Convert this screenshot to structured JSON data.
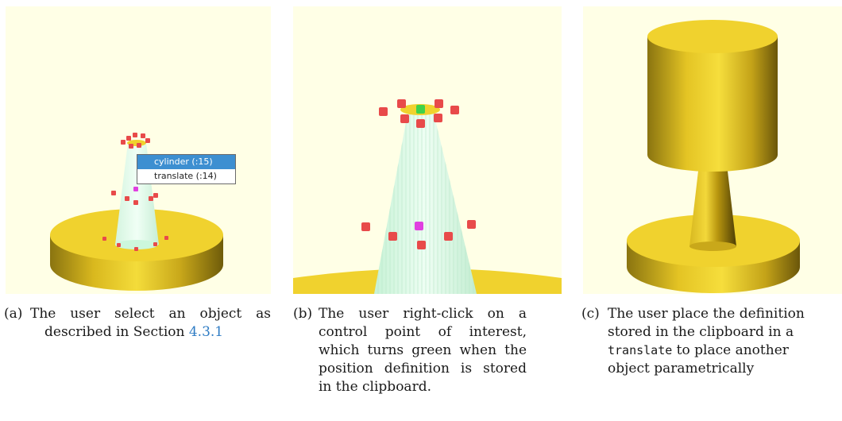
{
  "figure": {
    "panels": [
      {
        "id": "a",
        "context_menu": {
          "items": [
            {
              "label": "cylinder (:15)",
              "selected": true
            },
            {
              "label": "translate (:14)",
              "selected": false
            }
          ]
        }
      },
      {
        "id": "b"
      },
      {
        "id": "c"
      }
    ],
    "captions": {
      "a": {
        "tag": "(a)",
        "line1": "The user select an object as",
        "line2_pre": "described in Section ",
        "line2_link": "4.3.1"
      },
      "b": {
        "tag": "(b)",
        "line1": "The user right-click on a",
        "line2": "control point of interest,",
        "line3": "which turns green when the",
        "line4": "position definition is stored",
        "line5": "in the clipboard."
      },
      "c": {
        "tag": "(c)",
        "line1": "The user place the definition",
        "line2": "stored in the clipboard in a",
        "line3_code": "translate",
        "line3_post": " to place another",
        "line4": "object parametrically"
      }
    },
    "colors": {
      "viewport_bg": "#ffffe6",
      "gold": "#f0d22e",
      "control_point": "#e84a4a",
      "selected_point": "#e040e0",
      "stored_point": "#3fd24a",
      "selection_highlight": "#ccf7dc",
      "link": "#2f7cc4"
    }
  }
}
